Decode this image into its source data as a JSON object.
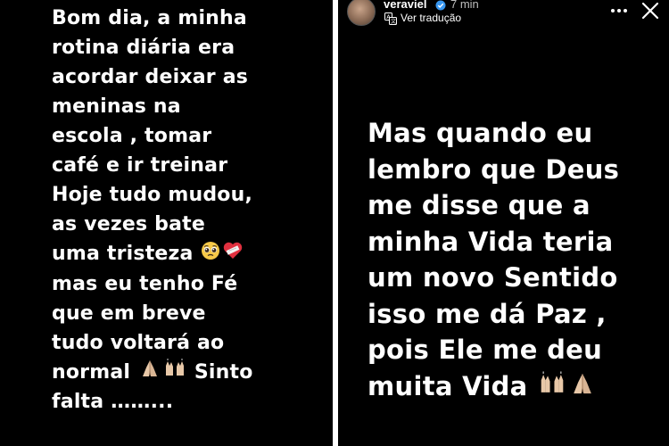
{
  "colors": {
    "panel_background": "#000000",
    "story_text": "#ffffff",
    "divider": "#ffffff",
    "time_text": "#bdbdbd"
  },
  "left_story": {
    "lines": [
      "Bom dia, a minha",
      "rotina diária era",
      "acordar deixar as",
      "meninas na",
      "escola , tomar",
      "café e ir treinar",
      "Hoje tudo mudou,",
      "as vezes bate",
      "uma tristeza",
      "mas eu tenho Fé",
      "que em breve",
      "tudo voltará ao",
      "normal",
      "Sinto",
      "falta ……..."
    ],
    "emojis": [
      "pleading-face",
      "mending-heart",
      "folded-hands",
      "raising-hands"
    ]
  },
  "right_story": {
    "header": {
      "username": "veraviel",
      "time": "7 min",
      "translate_label": "Ver tradução",
      "icons": [
        "avatar",
        "verified-badge-icon",
        "translate-icon",
        "more-options-icon",
        "close-icon"
      ]
    },
    "lines": [
      "Mas quando eu",
      "lembro que Deus",
      "me disse que a",
      "minha Vida teria",
      "um novo Sentido",
      "isso me dá Paz ,",
      "pois Ele me deu",
      "muita Vida"
    ],
    "emojis": [
      "raising-hands",
      "folded-hands"
    ]
  }
}
